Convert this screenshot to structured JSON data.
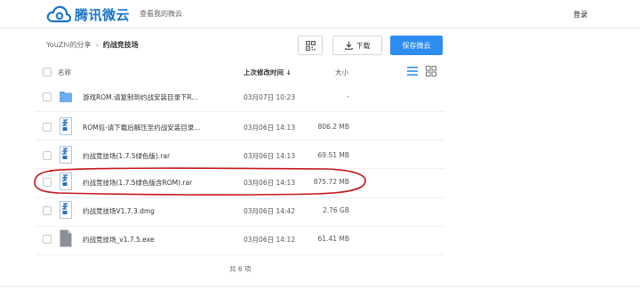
{
  "header": {
    "logo_text": "腾讯微云",
    "nav_link": "查看我的微云",
    "login": "登录"
  },
  "breadcrumb": {
    "root": "YouZhi的分享",
    "separator": "›",
    "current": "约战竞技场"
  },
  "toolbar": {
    "download_label": "下载",
    "save_label": "保存微云"
  },
  "table": {
    "col_name": "名称",
    "col_modified": "上次修改时间",
    "sort_arrow": "↓",
    "col_size": "大小"
  },
  "files": [
    {
      "icon": "folder-icon",
      "name": "游戏ROM.请复制到约战安装目录下R...",
      "date": "03月07日 10:23",
      "size": "-"
    },
    {
      "icon": "archive-icon",
      "name": "ROM包-请下载后解压至约战安装目录...",
      "date": "03月06日 14:13",
      "size": "806.2 MB"
    },
    {
      "icon": "archive-icon",
      "name": "约战竞技场(1.7.5绿色版).rar",
      "date": "03月06日 14:13",
      "size": "69.51 MB"
    },
    {
      "icon": "archive-icon",
      "name": "约战竞技场(1.7.5绿色版含ROM).rar",
      "date": "03月06日 14:13",
      "size": "875.72 MB"
    },
    {
      "icon": "archive-icon",
      "name": "约战竞技场V1.7.3.dmg",
      "date": "03月06日 14:42",
      "size": "2.76 GB"
    },
    {
      "icon": "document-icon",
      "name": "约战竞技场_v1.7.5.exe",
      "date": "03月06日 14:12",
      "size": "61.41 MB"
    }
  ],
  "footer": {
    "count": "共 6 项"
  },
  "colors": {
    "accent": "#2d8cf0",
    "brand": "#1a73c7",
    "highlight_stroke": "#c4161c"
  }
}
